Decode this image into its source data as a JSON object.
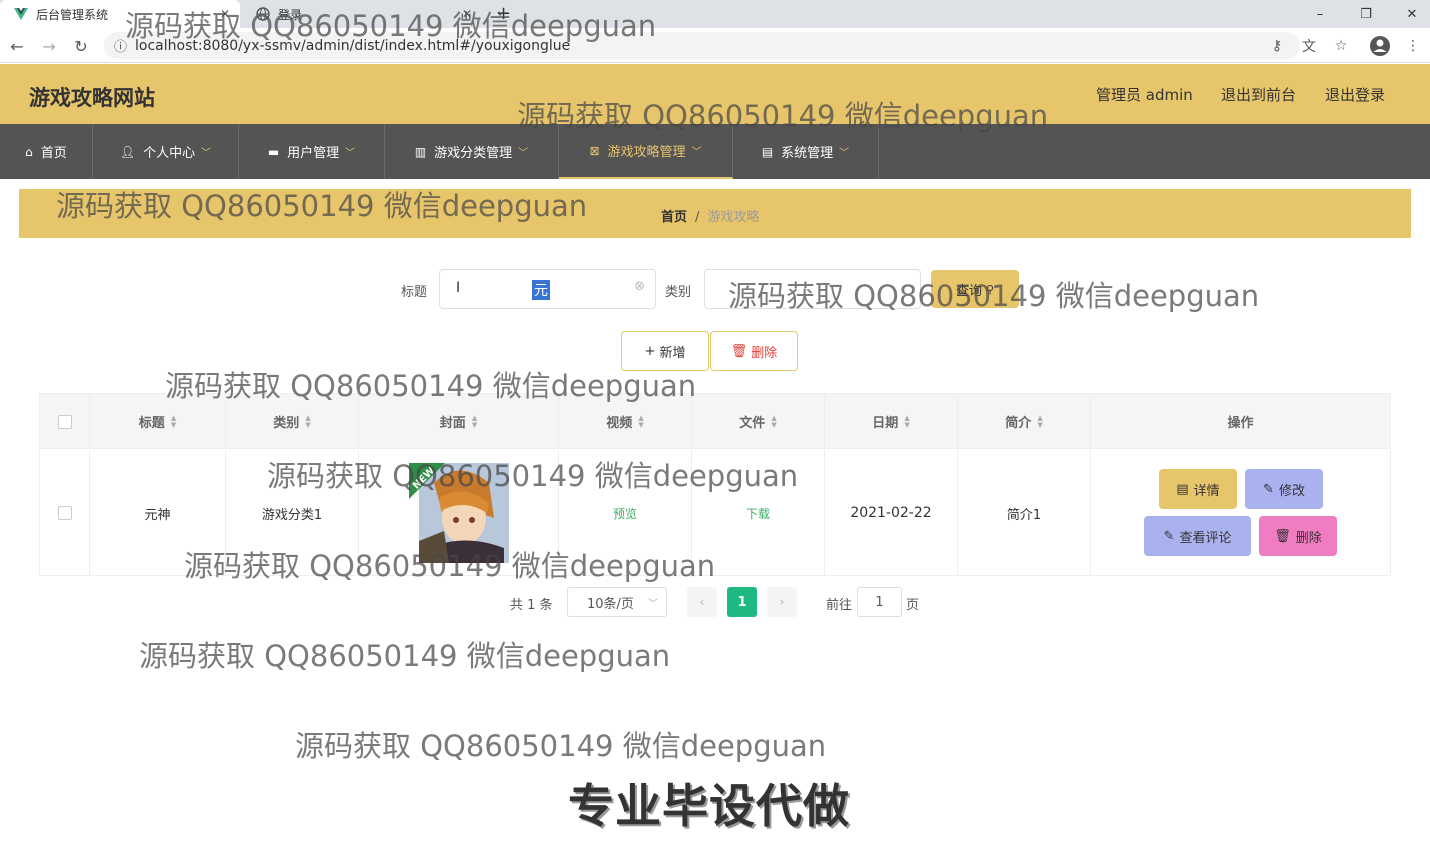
{
  "browser": {
    "tabs": [
      {
        "label": "后台管理系统",
        "active": true
      },
      {
        "label": "登录",
        "active": false
      }
    ],
    "new_tab": "+",
    "url": "localhost:8080/yx-ssmv/admin/dist/index.html#/youxigonglue",
    "window_controls": {
      "minimize": "–",
      "restore": "❐",
      "close": "✕"
    }
  },
  "header": {
    "site_title": "游戏攻略网站",
    "user_label": "管理员 admin",
    "exit_front": "退出到前台",
    "logout": "退出登录"
  },
  "nav": {
    "items": [
      {
        "label": "首页",
        "icon": "home-icon",
        "dropdown": false
      },
      {
        "label": "个人中心",
        "icon": "user-icon",
        "dropdown": true
      },
      {
        "label": "用户管理",
        "icon": "briefcase-icon",
        "dropdown": true
      },
      {
        "label": "游戏分类管理",
        "icon": "book-icon",
        "dropdown": true
      },
      {
        "label": "游戏攻略管理",
        "icon": "grid-icon",
        "dropdown": true,
        "active": true
      },
      {
        "label": "系统管理",
        "icon": "clipboard-icon",
        "dropdown": true
      }
    ]
  },
  "breadcrumb": {
    "home": "首页",
    "separator": "/",
    "current": "游戏攻略"
  },
  "search": {
    "title_label": "标题",
    "title_value": "元",
    "category_label": "类别",
    "search_button": "查询"
  },
  "actions": {
    "add": "新增",
    "delete": "删除"
  },
  "table": {
    "columns": [
      "标题",
      "类别",
      "封面",
      "视频",
      "文件",
      "日期",
      "简介",
      "操作"
    ],
    "rows": [
      {
        "title": "元神",
        "category": "游戏分类1",
        "cover_badge": "NEW",
        "video": "预览",
        "file": "下载",
        "date": "2021-02-22",
        "intro": "简介1",
        "ops": {
          "detail": "详情",
          "edit": "修改",
          "comments": "查看评论",
          "delete": "删除"
        }
      }
    ]
  },
  "pagination": {
    "total": "共 1 条",
    "page_size": "10条/页",
    "current_page": "1",
    "goto_label": "前往",
    "goto_value": "1",
    "page_suffix": "页"
  },
  "watermark": "源码获取 QQ86050149 微信deepguan",
  "promo": "专业毕设代做",
  "colors": {
    "accent": "#e7c56b",
    "nav_bg": "#545454",
    "link_green": "#3aae64",
    "edit_btn": "#a9b2ef",
    "delete_btn": "#f07cc2"
  }
}
